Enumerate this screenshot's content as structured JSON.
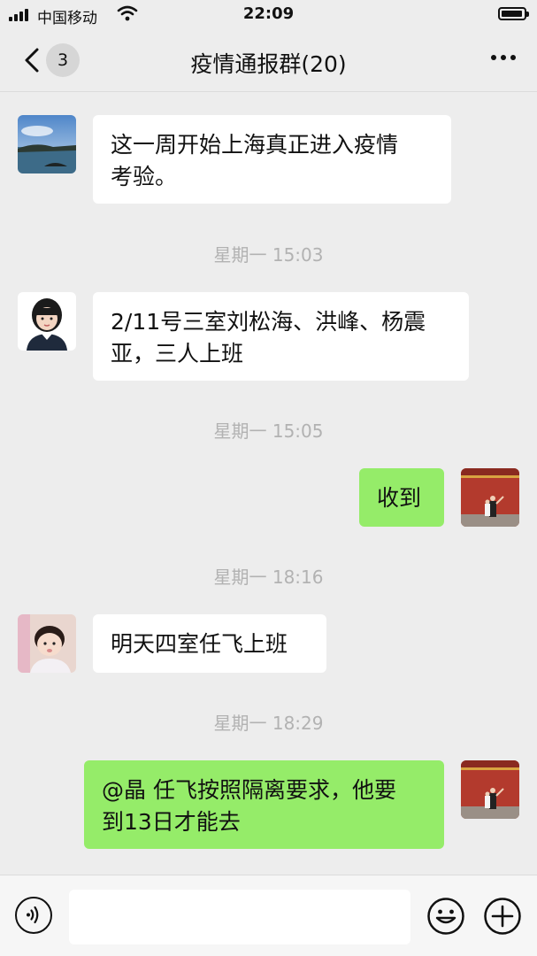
{
  "status_bar": {
    "carrier": "中国移动",
    "time": "22:09"
  },
  "header": {
    "unread_count": "3",
    "title": "疫情通报群(20)"
  },
  "messages": [
    {
      "side": "in",
      "text_lines": [
        "这一周开始上海真正进入疫情",
        "考验。"
      ],
      "avatar": "landscape-photo"
    },
    {
      "timestamp": "星期一 15:03"
    },
    {
      "side": "in",
      "text_lines": [
        "2/11号三室刘松海、洪峰、杨震",
        "亚，三人上班"
      ],
      "avatar": "girl-portrait"
    },
    {
      "timestamp": "星期一 15:05"
    },
    {
      "side": "out",
      "text_lines": [
        "收到"
      ],
      "avatar": "red-wall-photo"
    },
    {
      "timestamp": "星期一 18:16"
    },
    {
      "side": "in",
      "text_lines": [
        "明天四室任飞上班"
      ],
      "avatar": "baby-photo"
    },
    {
      "timestamp": "星期一 18:29"
    },
    {
      "side": "out",
      "text_lines": [
        "@晶 任飞按照隔离要求，他要",
        "到13日才能去"
      ],
      "avatar": "red-wall-photo"
    }
  ],
  "input_bar": {
    "placeholder": ""
  },
  "colors": {
    "background": "#ededed",
    "incoming_bubble": "#ffffff",
    "outgoing_bubble": "#95ec69",
    "timestamp_text": "#b2b2b2"
  }
}
